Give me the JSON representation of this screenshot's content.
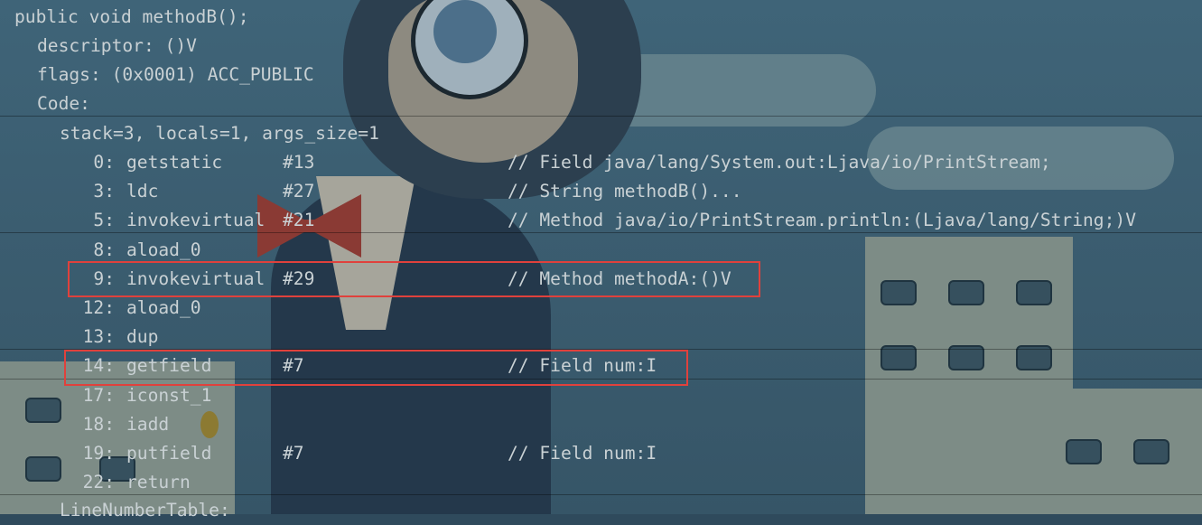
{
  "header": {
    "signature": "public void methodB();",
    "descriptor": "descriptor: ()V",
    "flags": "flags: (0x0001) ACC_PUBLIC",
    "code_label": "Code:",
    "stack_info": "stack=3, locals=1, args_size=1"
  },
  "instructions": [
    {
      "index": "0:",
      "opcode": "getstatic",
      "operand": "#13",
      "comment": "// Field java/lang/System.out:Ljava/io/PrintStream;"
    },
    {
      "index": "3:",
      "opcode": "ldc",
      "operand": "#27",
      "comment": "// String methodB()..."
    },
    {
      "index": "5:",
      "opcode": "invokevirtual",
      "operand": "#21",
      "comment": "// Method java/io/PrintStream.println:(Ljava/lang/String;)V"
    },
    {
      "index": "8:",
      "opcode": "aload_0",
      "operand": "",
      "comment": ""
    },
    {
      "index": "9:",
      "opcode": "invokevirtual",
      "operand": "#29",
      "comment": "// Method methodA:()V"
    },
    {
      "index": "12:",
      "opcode": "aload_0",
      "operand": "",
      "comment": ""
    },
    {
      "index": "13:",
      "opcode": "dup",
      "operand": "",
      "comment": ""
    },
    {
      "index": "14:",
      "opcode": "getfield",
      "operand": "#7",
      "comment": "// Field num:I"
    },
    {
      "index": "17:",
      "opcode": "iconst_1",
      "operand": "",
      "comment": ""
    },
    {
      "index": "18:",
      "opcode": "iadd",
      "operand": "",
      "comment": ""
    },
    {
      "index": "19:",
      "opcode": "putfield",
      "operand": "#7",
      "comment": "// Field num:I"
    },
    {
      "index": "22:",
      "opcode": "return",
      "operand": "",
      "comment": ""
    }
  ],
  "footer": {
    "line_number_table": "LineNumberTable:"
  },
  "highlights": {
    "color": "#e0413c",
    "instruction_indices": [
      "9:",
      "14:"
    ]
  },
  "theme": {
    "text_color": "#c9d1d4"
  }
}
